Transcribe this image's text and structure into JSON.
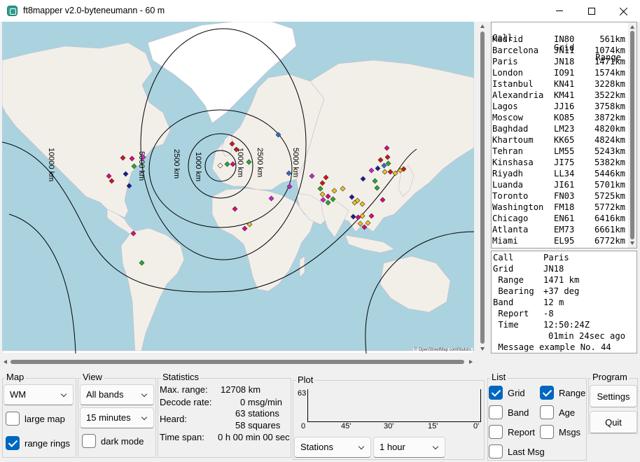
{
  "window": {
    "title": "ft8mapper v2.0-byteneumann - 60 m"
  },
  "map": {
    "attribution": "© OpenStreetMap contributors",
    "ring_labels": [
      "10000 km",
      "5000 km",
      "2500 km",
      "1000 km",
      "1000 km",
      "2500 km",
      "5000 km"
    ]
  },
  "stations_list": {
    "headers": {
      "call": "Call",
      "grid": "Grid",
      "range": "Range"
    },
    "rows": [
      {
        "call": "Madrid",
        "grid": "IN80",
        "range": "561km"
      },
      {
        "call": "Barcelona",
        "grid": "JN11",
        "range": "1074km"
      },
      {
        "call": "Paris",
        "grid": "JN18",
        "range": "1471km"
      },
      {
        "call": "London",
        "grid": "IO91",
        "range": "1574km"
      },
      {
        "call": "Istanbul",
        "grid": "KN41",
        "range": "3228km"
      },
      {
        "call": "Alexandria",
        "grid": "KM41",
        "range": "3522km"
      },
      {
        "call": "Lagos",
        "grid": "JJ16",
        "range": "3758km"
      },
      {
        "call": "Moscow",
        "grid": "KO85",
        "range": "3872km"
      },
      {
        "call": "Baghdad",
        "grid": "LM23",
        "range": "4820km"
      },
      {
        "call": "Khartoum",
        "grid": "KK65",
        "range": "4824km"
      },
      {
        "call": "Tehran",
        "grid": "LM55",
        "range": "5243km"
      },
      {
        "call": "Kinshasa",
        "grid": "JI75",
        "range": "5382km"
      },
      {
        "call": "Riyadh",
        "grid": "LL34",
        "range": "5446km"
      },
      {
        "call": "Luanda",
        "grid": "JI61",
        "range": "5701km"
      },
      {
        "call": "Toronto",
        "grid": "FN03",
        "range": "5725km"
      },
      {
        "call": "Washington",
        "grid": "FM18",
        "range": "5772km"
      },
      {
        "call": "Chicago",
        "grid": "EN61",
        "range": "6416km"
      },
      {
        "call": "Atlanta",
        "grid": "EM73",
        "range": "6661km"
      },
      {
        "call": "Miami",
        "grid": "EL95",
        "range": "6772km"
      }
    ]
  },
  "detail": {
    "call_label": "Call",
    "call": "Paris",
    "grid_label": "Grid",
    "grid": "JN18",
    "range_label": " Range",
    "range": "1471 km",
    "bearing_label": " Bearing",
    "bearing": "+37 deg",
    "band_label": "Band",
    "band": "12 m",
    "report_label": " Report",
    "report": "-8",
    "time_label": " Time",
    "time": "12:50:24Z",
    "ago": "01min 24sec ago",
    "message": " Message example No. 44"
  },
  "map_group": {
    "label": "Map",
    "projection": "WM",
    "large_map": "large map",
    "range_rings": "range rings",
    "large_map_checked": false,
    "range_rings_checked": true
  },
  "view_group": {
    "label": "View",
    "bands": "All bands",
    "window": "15 minutes",
    "dark_mode": "dark mode",
    "dark_mode_checked": false
  },
  "statistics": {
    "label": "Statistics",
    "max_range_label": "Max. range:",
    "max_range": "12708 km",
    "decode_rate_label": "Decode rate:",
    "decode_rate": "0 msg/min",
    "heard_label": "Heard:",
    "heard_stations": "63 stations",
    "heard_squares": "58 squares",
    "time_span_label": "Time span:",
    "time_span": "0 h 00 min 00 sec"
  },
  "plot_group": {
    "label": "Plot",
    "y_max": "63",
    "y_min": "0",
    "x_ticks": [
      "45'",
      "30'",
      "15'",
      "0'"
    ],
    "source": "Stations",
    "period": "1 hour"
  },
  "list_group": {
    "label": "List",
    "grid": "Grid",
    "range": "Range",
    "band": "Band",
    "age": "Age",
    "report": "Report",
    "msgs": "Msgs",
    "last_msg": "Last Msg",
    "checked": {
      "grid": true,
      "range": true,
      "band": false,
      "age": false,
      "report": false,
      "msgs": false,
      "last_msg": false
    }
  },
  "program_group": {
    "label": "Program",
    "settings": "Settings",
    "quit": "Quit"
  },
  "colors": {
    "ocean": "#aad3df",
    "land": "#f2efe9",
    "ice": "#ffffff",
    "accent": "#0067c0"
  }
}
